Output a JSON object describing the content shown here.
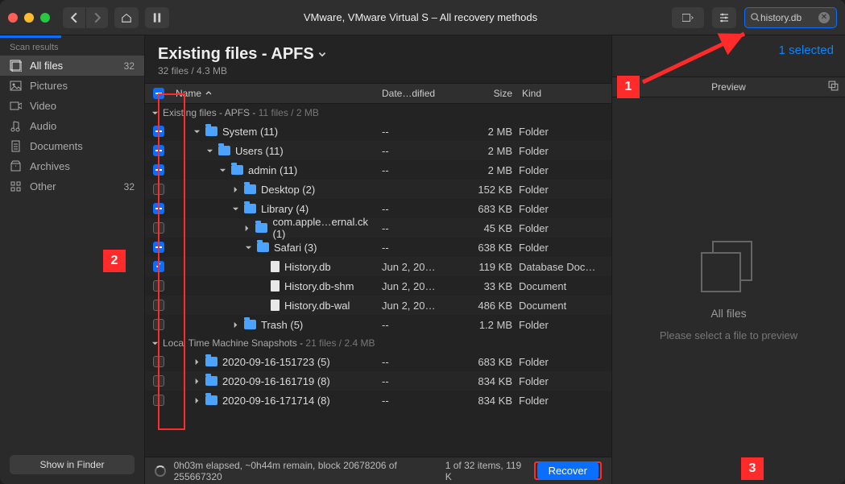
{
  "titlebar": {
    "title": "VMware, VMware Virtual S – All recovery methods"
  },
  "search": {
    "value": "history.db"
  },
  "sidebar": {
    "section": "Scan results",
    "items": [
      {
        "label": "All files",
        "count": "32",
        "selected": true
      },
      {
        "label": "Pictures",
        "count": ""
      },
      {
        "label": "Video",
        "count": ""
      },
      {
        "label": "Audio",
        "count": ""
      },
      {
        "label": "Documents",
        "count": ""
      },
      {
        "label": "Archives",
        "count": ""
      },
      {
        "label": "Other",
        "count": "32"
      }
    ],
    "footer_button": "Show in Finder"
  },
  "content": {
    "heading": "Existing files - APFS",
    "sub": "32 files / 4.3 MB",
    "selected_text": "1 selected"
  },
  "columns": {
    "name": "Name",
    "date": "Date…dified",
    "size": "Size",
    "kind": "Kind"
  },
  "groups": [
    {
      "title": "Existing files - APFS",
      "meta": "11 files / 2 MB"
    },
    {
      "title": "Local Time Machine Snapshots",
      "meta": "21 files / 2.4 MB"
    }
  ],
  "rows_a": [
    {
      "chk": "minus",
      "indent": 20,
      "disc": "down",
      "type": "folder",
      "name": "System (11)",
      "date": "--",
      "size": "2 MB",
      "kind": "Folder"
    },
    {
      "chk": "minus",
      "indent": 36,
      "disc": "down",
      "type": "folder",
      "name": "Users (11)",
      "date": "--",
      "size": "2 MB",
      "kind": "Folder"
    },
    {
      "chk": "minus",
      "indent": 52,
      "disc": "down",
      "type": "folder",
      "name": "admin (11)",
      "date": "--",
      "size": "2 MB",
      "kind": "Folder"
    },
    {
      "chk": "none",
      "indent": 68,
      "disc": "right",
      "type": "folder",
      "name": "Desktop (2)",
      "date": "",
      "size": "152 KB",
      "kind": "Folder"
    },
    {
      "chk": "minus",
      "indent": 68,
      "disc": "down",
      "type": "folder",
      "name": "Library (4)",
      "date": "--",
      "size": "683 KB",
      "kind": "Folder"
    },
    {
      "chk": "none",
      "indent": 84,
      "disc": "right",
      "type": "folder",
      "name": "com.apple…ernal.ck (1)",
      "date": "--",
      "size": "45 KB",
      "kind": "Folder"
    },
    {
      "chk": "minus",
      "indent": 84,
      "disc": "down",
      "type": "folder",
      "name": "Safari (3)",
      "date": "--",
      "size": "638 KB",
      "kind": "Folder"
    },
    {
      "chk": "checked",
      "indent": 100,
      "disc": "",
      "type": "file",
      "name": "History.db",
      "date": "Jun 2, 20…",
      "size": "119 KB",
      "kind": "Database Doc…"
    },
    {
      "chk": "none",
      "indent": 100,
      "disc": "",
      "type": "file",
      "name": "History.db-shm",
      "date": "Jun 2, 20…",
      "size": "33 KB",
      "kind": "Document"
    },
    {
      "chk": "none",
      "indent": 100,
      "disc": "",
      "type": "file",
      "name": "History.db-wal",
      "date": "Jun 2, 20…",
      "size": "486 KB",
      "kind": "Document"
    },
    {
      "chk": "none",
      "indent": 68,
      "disc": "right",
      "type": "folder",
      "name": "Trash (5)",
      "date": "--",
      "size": "1.2 MB",
      "kind": "Folder"
    }
  ],
  "rows_b": [
    {
      "chk": "none",
      "indent": 20,
      "disc": "right",
      "type": "folder",
      "name": "2020-09-16-151723 (5)",
      "date": "--",
      "size": "683 KB",
      "kind": "Folder"
    },
    {
      "chk": "none",
      "indent": 20,
      "disc": "right",
      "type": "folder",
      "name": "2020-09-16-161719 (8)",
      "date": "--",
      "size": "834 KB",
      "kind": "Folder"
    },
    {
      "chk": "none",
      "indent": 20,
      "disc": "right",
      "type": "folder",
      "name": "2020-09-16-171714 (8)",
      "date": "--",
      "size": "834 KB",
      "kind": "Folder"
    }
  ],
  "preview": {
    "header": "Preview",
    "title": "All files",
    "hint": "Please select a file to preview"
  },
  "status": {
    "elapsed": "0h03m elapsed, ~0h44m remain, block 20678206 of 255667320",
    "right": "1 of 32 items, 119 K",
    "recover": "Recover"
  },
  "annotations": {
    "a1": "1",
    "a2": "2",
    "a3": "3"
  }
}
